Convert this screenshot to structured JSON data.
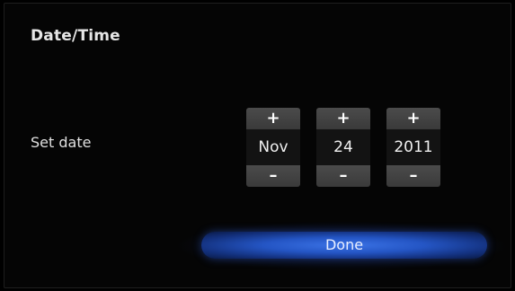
{
  "header": {
    "title": "Date/Time"
  },
  "date_setting": {
    "label": "Set date",
    "increment_symbol": "+",
    "decrement_symbol": "–",
    "month": "Nov",
    "day": "24",
    "year": "2011"
  },
  "actions": {
    "done_label": "Done"
  },
  "colors": {
    "background": "#000000",
    "button_accent": "#2f66d8",
    "spinner_button": "#444444",
    "text": "#e6e6e6"
  }
}
